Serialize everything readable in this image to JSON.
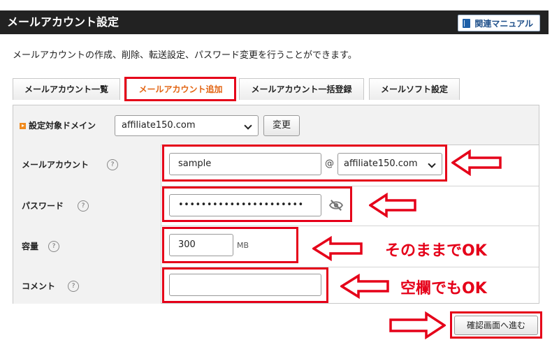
{
  "header": {
    "title": "メールアカウント設定",
    "manual_label": "関連マニュアル"
  },
  "description": "メールアカウントの作成、削除、転送設定、パスワード変更を行うことができます。",
  "tabs": [
    {
      "label": "メールアカウント一覧",
      "active": false
    },
    {
      "label": "メールアカウント追加",
      "active": true
    },
    {
      "label": "メールアカウント一括登録",
      "active": false
    },
    {
      "label": "メールソフト設定",
      "active": false
    }
  ],
  "domain_row": {
    "label": "設定対象ドメイン",
    "selected": "affiliate150.com",
    "change_button": "変更"
  },
  "fields": {
    "account": {
      "label": "メールアカウント",
      "help": "?",
      "value": "sample",
      "at": "@",
      "domain": "affiliate150.com"
    },
    "password": {
      "label": "パスワード",
      "help": "?",
      "value": "••••••••••••••••••••••"
    },
    "quota": {
      "label": "容量",
      "help": "?",
      "value": "300",
      "unit": "MB"
    },
    "comment": {
      "label": "コメント",
      "help": "?",
      "value": ""
    }
  },
  "annotations": {
    "quota_note": "そのままでOK",
    "comment_note": "空欄でもOK"
  },
  "confirm_button": "確認画面へ進む",
  "colors": {
    "header_bg": "#222222",
    "active_tab_text": "#e26412",
    "annotation_red": "#e50019",
    "marker_orange": "#f08a1d"
  },
  "icons": {
    "manual": "book-icon",
    "domain": "orange-play-marker",
    "password_toggle": "eye-slash-icon",
    "help": "question-circle-icon",
    "select": "chevron-down-icon"
  }
}
